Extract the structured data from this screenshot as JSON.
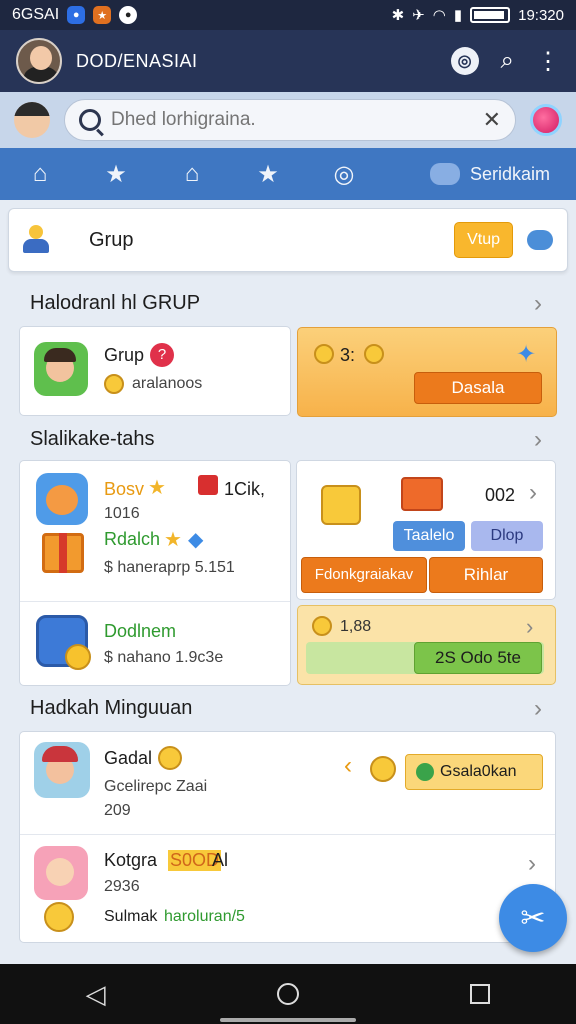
{
  "status": {
    "left_text": "6GSAI",
    "time": "19:320"
  },
  "appbar": {
    "title": "DOD/ENASIAI"
  },
  "search": {
    "placeholder": "Dhed lorhigraina."
  },
  "tabs": {
    "last_label": "Seridkaim"
  },
  "group": {
    "label": "Grup",
    "button": "Vtup"
  },
  "section1": {
    "title": "Halodranl hl GRUP"
  },
  "grup_card": {
    "name": "Grup",
    "sub": "aralanoos"
  },
  "promo": {
    "value": "3:",
    "button": "Dasala"
  },
  "section2": {
    "title": "Slalikake-tahs"
  },
  "bosv_card": {
    "name": "Bosv",
    "extra": "1Cik,",
    "num": "1016",
    "line2": "Rdalch",
    "price": "$ haneraprp 5.151"
  },
  "reward_panel": {
    "count": "002",
    "btn_a": "Taalelo",
    "btn_b": "Dlop",
    "wide_a": "Fdonkgraiakav",
    "wide_b": "Rihlar"
  },
  "dodlnem_card": {
    "name": "Dodlnem",
    "price": "$ nahano 1.9c3e"
  },
  "coin_panel": {
    "value": "1,88",
    "button": "2S Odo 5te"
  },
  "section3": {
    "title": "Hadkah Minguuan"
  },
  "gadal_item": {
    "name": "Gadal",
    "sub": "Gcelirepc Zaai",
    "num": "209",
    "pill": "Gsala0kan"
  },
  "kotgra_item": {
    "name": "Kotgra",
    "highlight": "S0OD",
    "suffix": "Al",
    "num": "2936",
    "line": "Sulmak",
    "line_green": "haroluran/5"
  },
  "colors": {
    "primary": "#273457",
    "accent": "#3f77c2",
    "orange": "#ec7a1c",
    "gold": "#f8c93a",
    "green": "#7cc44a"
  }
}
